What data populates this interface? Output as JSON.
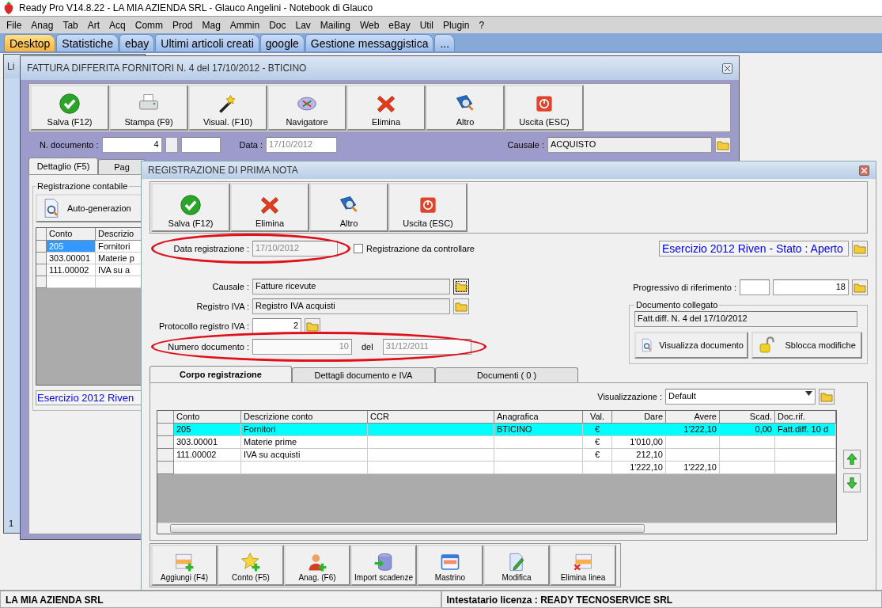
{
  "app_title": "Ready Pro V14.8.22 - LA MIA AZIENDA SRL - Glauco Angelini - Notebook di Glauco",
  "menu": [
    "File",
    "Anag",
    "Tab",
    "Art",
    "Acq",
    "Comm",
    "Prod",
    "Mag",
    "Ammin",
    "Doc",
    "Lav",
    "Mailing",
    "Web",
    "eBay",
    "Util",
    "Plugin",
    "?"
  ],
  "tabs": [
    {
      "label": "Desktop",
      "selected": true
    },
    {
      "label": "Statistiche",
      "selected": false
    },
    {
      "label": "ebay",
      "selected": false
    },
    {
      "label": "Ultimi articoli creati",
      "selected": false
    },
    {
      "label": "google",
      "selected": false
    },
    {
      "label": "Gestione messaggistica",
      "selected": false
    },
    {
      "label": "...",
      "selected": false
    }
  ],
  "behind_window": {
    "title": "Li",
    "page_label": "1"
  },
  "invoice_window": {
    "title": "FATTURA DIFFERITA FORNITORI N. 4  del 17/10/2012 - BTICINO",
    "toolbar": [
      {
        "kind": "save",
        "label": "Salva (F12)"
      },
      {
        "kind": "print",
        "label": "Stampa (F9)"
      },
      {
        "kind": "visual",
        "label": "Visual. (F10)"
      },
      {
        "kind": "navigator",
        "label": "Navigatore"
      },
      {
        "kind": "delete",
        "label": "Elimina"
      },
      {
        "kind": "other",
        "label": "Altro"
      },
      {
        "kind": "exit",
        "label": "Uscita (ESC)"
      }
    ],
    "doc_number_label": "N. documento :",
    "doc_number": "4",
    "date_label": "Data :",
    "date": "17/10/2012",
    "causale_label": "Causale :",
    "causale": "ACQUISTO",
    "tabs": [
      {
        "label": "Dettaglio (F5)",
        "selected": true
      },
      {
        "label": "Pag",
        "selected": false
      }
    ],
    "group_title": "Registrazione contabile",
    "autogen_label": "Auto-generazion",
    "table": {
      "columns": [
        "Conto",
        "Descrizio"
      ],
      "rows": [
        {
          "cells": [
            "205",
            "Fornitori"
          ],
          "selected": true
        },
        {
          "cells": [
            "303.00001",
            "Materie p"
          ],
          "selected": false
        },
        {
          "cells": [
            "111.00002",
            "IVA su a"
          ],
          "selected": false
        }
      ]
    },
    "exercise_text": "Esercizio 2012 Riven"
  },
  "prima_nota": {
    "title": "REGISTRAZIONE DI PRIMA NOTA",
    "toolbar": [
      {
        "kind": "save",
        "label": "Salva (F12)"
      },
      {
        "kind": "delete",
        "label": "Elimina"
      },
      {
        "kind": "other",
        "label": "Altro"
      },
      {
        "kind": "exit",
        "label": "Uscita (ESC)"
      }
    ],
    "data_registrazione": {
      "label": "Data registrazione :",
      "value": "17/10/2012",
      "highlighted": true
    },
    "da_controllare": {
      "label": "Registrazione da controllare",
      "checked": false
    },
    "esercizio": "Esercizio 2012 Riven - Stato : Aperto",
    "causale": {
      "label": "Causale :",
      "value": "Fatture ricevute"
    },
    "registro_iva": {
      "label": "Registro IVA :",
      "value": "Registro IVA acquisti"
    },
    "protocollo": {
      "label": "Protocollo registro IVA :",
      "value": "2"
    },
    "numero_documento": {
      "label": "Numero documento :",
      "value": "10",
      "del_label": "del",
      "del_value": "31/12/2011",
      "highlighted": true
    },
    "progressivo": {
      "label": "Progressivo di riferimento :",
      "value": "18"
    },
    "documento_collegato": {
      "title": "Documento collegato",
      "value": "Fatt.diff. N. 4 del 17/10/2012",
      "buttons": [
        {
          "kind": "doc-view",
          "label": "Visualizza documento"
        },
        {
          "kind": "unlock",
          "label": "Sblocca modifiche"
        }
      ]
    },
    "tabs": [
      {
        "label": "Corpo registrazione",
        "selected": true
      },
      {
        "label": "Dettagli documento e IVA",
        "selected": false
      },
      {
        "label": "Documenti ( 0 )",
        "selected": false
      }
    ],
    "view_label": "Visualizzazione :",
    "view_value": "Default",
    "grid": {
      "columns": [
        "Conto",
        "Descrizione conto",
        "CCR",
        "Anagrafica",
        "Val.",
        "Dare",
        "Avere",
        "Scad.",
        "Doc.rif."
      ],
      "rows": [
        {
          "selected": true,
          "cells": [
            "205",
            "Fornitori",
            null,
            "BTICINO",
            "€",
            null,
            "1'222,10",
            "0,00",
            "Fatt.diff. 10 d"
          ]
        },
        {
          "selected": false,
          "cells": [
            "303.00001",
            "Materie prime",
            null,
            null,
            "€",
            "1'010,00",
            null,
            null,
            null
          ]
        },
        {
          "selected": false,
          "cells": [
            "111.00002",
            "IVA su acquisti",
            null,
            null,
            "€",
            "212,10",
            null,
            null,
            null
          ]
        },
        {
          "selected": false,
          "cells": [
            null,
            null,
            null,
            null,
            null,
            "1'222,10",
            "1'222,10",
            null,
            null
          ]
        }
      ]
    },
    "bottom_toolbar": [
      {
        "kind": "add-row",
        "label": "Aggiungi (F4)"
      },
      {
        "kind": "conto",
        "label": "Conto (F5)"
      },
      {
        "kind": "anag",
        "label": "Anag. (F6)"
      },
      {
        "kind": "import",
        "label": "Import scadenze"
      },
      {
        "kind": "mastrino",
        "label": "Mastrino"
      },
      {
        "kind": "modifica",
        "label": "Modifica"
      },
      {
        "kind": "elimina-linea",
        "label": "Elimina linea"
      }
    ]
  },
  "status_bar": [
    "LA MIA AZIENDA SRL",
    "Intestatario licenza : READY TECNOSERVICE SRL"
  ]
}
